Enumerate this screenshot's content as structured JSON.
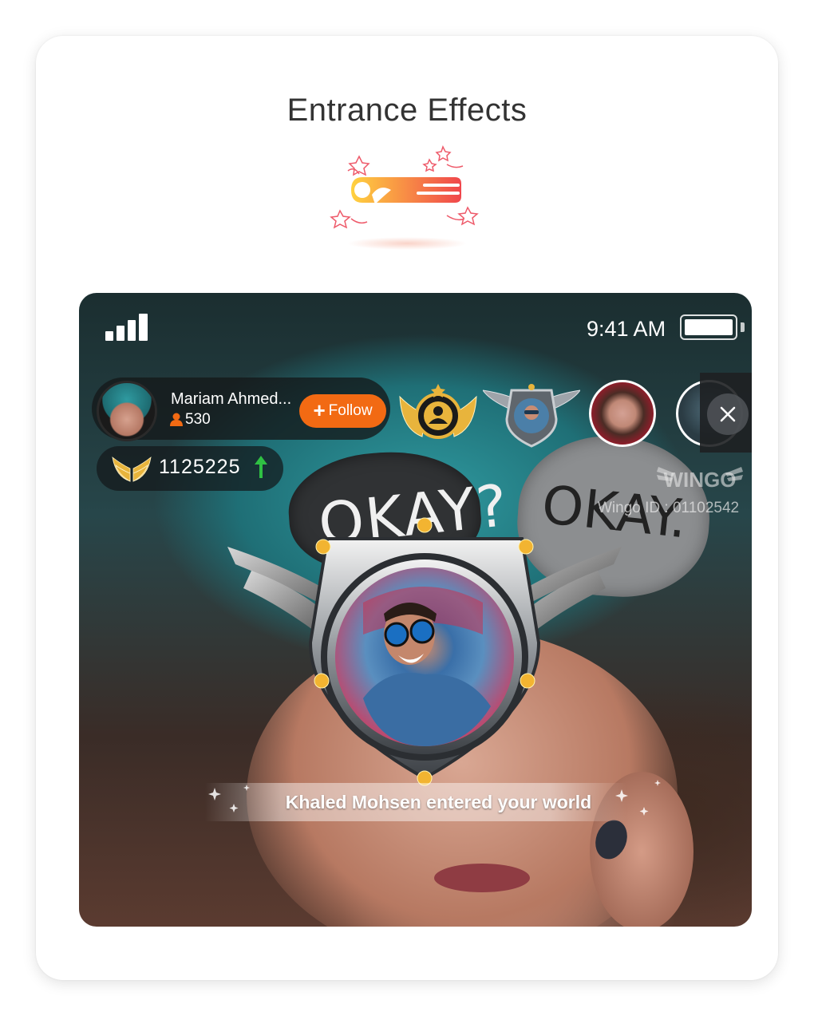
{
  "page": {
    "title": "Entrance Effects"
  },
  "status_bar": {
    "time": "9:41 AM"
  },
  "host": {
    "name": "Mariam Ahmed...",
    "followers": "530",
    "follow_label": "Follow"
  },
  "coins": {
    "value": "1125225"
  },
  "watermark": {
    "brand": "WINGO",
    "id_label": "Wingo ID : 01102542"
  },
  "entrance": {
    "message": "Khaled Mohsen entered your world"
  },
  "photo": {
    "hat_text_1": "OKAY?",
    "hat_text_2": "OKAY."
  },
  "colors": {
    "accent": "#f26a13",
    "arrow": "#2fc043",
    "gold": "#e8b43c"
  },
  "icons": [
    "signal-icon",
    "battery-icon",
    "person-icon",
    "plus-icon",
    "wings-icon",
    "arrow-up-icon",
    "gold-badge-icon",
    "shield-badge-icon",
    "close-icon",
    "comet-icon"
  ]
}
